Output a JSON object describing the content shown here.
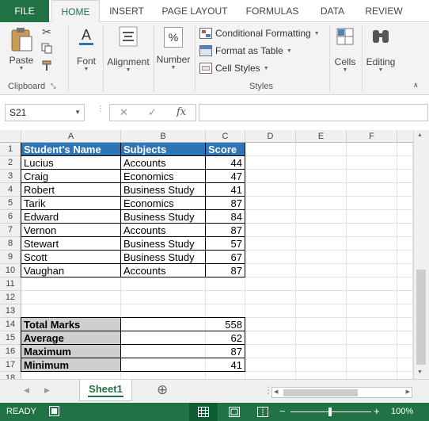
{
  "ribbon_tabs": [
    "FILE",
    "HOME",
    "INSERT",
    "PAGE LAYOUT",
    "FORMULAS",
    "DATA",
    "REVIEW"
  ],
  "clipboard": {
    "paste_label": "Paste",
    "group_label": "Clipboard"
  },
  "font": {
    "label": "Font"
  },
  "alignment": {
    "label": "Alignment"
  },
  "number": {
    "label": "Number",
    "icon_glyph": "%"
  },
  "styles": {
    "conditional_formatting": "Conditional Formatting",
    "format_as_table": "Format as Table",
    "cell_styles": "Cell Styles",
    "group_label": "Styles"
  },
  "cells": {
    "label": "Cells"
  },
  "editing": {
    "label": "Editing"
  },
  "namebox": {
    "value": "S21"
  },
  "formula_bar": {
    "fx": "fx",
    "cancel": "✕",
    "enter": "✓"
  },
  "columns": [
    "A",
    "B",
    "C",
    "D",
    "E",
    "F"
  ],
  "rows": [
    "1",
    "2",
    "3",
    "4",
    "5",
    "6",
    "7",
    "8",
    "9",
    "10",
    "11",
    "12",
    "13",
    "14",
    "15",
    "16",
    "17",
    "18"
  ],
  "table": {
    "headers": [
      "Student's Name",
      "Subjects",
      "Score"
    ],
    "rows": [
      [
        "Lucius",
        "Accounts",
        "44"
      ],
      [
        "Craig",
        "Economics",
        "47"
      ],
      [
        "Robert",
        "Business Study",
        "41"
      ],
      [
        "Tarik",
        "Economics",
        "87"
      ],
      [
        "Edward",
        "Business Study",
        "84"
      ],
      [
        "Vernon",
        "Accounts",
        "87"
      ],
      [
        "Stewart",
        "Business Study",
        "57"
      ],
      [
        "Scott",
        "Business Study",
        "67"
      ],
      [
        "Vaughan",
        "Accounts",
        "87"
      ]
    ]
  },
  "summary": [
    [
      "Total Marks",
      "558"
    ],
    [
      "Average",
      "62"
    ],
    [
      "Maximum",
      "87"
    ],
    [
      "Minimum",
      "41"
    ]
  ],
  "sheet_tab": "Sheet1",
  "add_sheet": "⊕",
  "status": {
    "ready": "READY",
    "zoom": "100%"
  },
  "colors": {
    "accent": "#217346",
    "table_header": "#2e75b6",
    "summary_fill": "#d0cece"
  }
}
